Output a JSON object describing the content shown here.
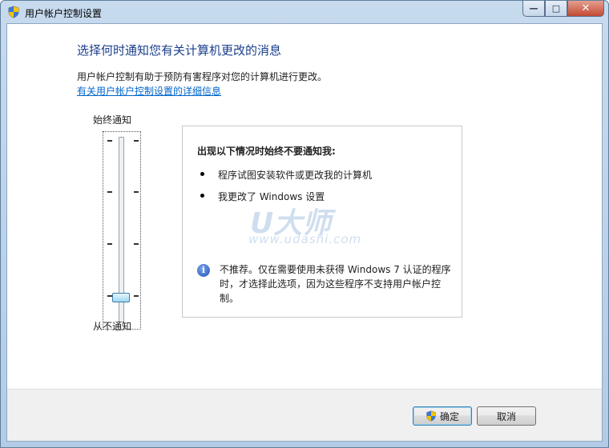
{
  "window": {
    "title": "用户帐户控制设置",
    "caption_buttons": {
      "minimize": "—",
      "maximize": "□",
      "close": "✕"
    }
  },
  "content": {
    "heading": "选择何时通知您有关计算机更改的消息",
    "description": "用户帐户控制有助于预防有害程序对您的计算机进行更改。",
    "help_link": "有关用户帐户控制设置的详细信息"
  },
  "slider": {
    "top_label": "始终通知",
    "bottom_label": "从不通知",
    "levels": 4,
    "current_level": 1,
    "current_level_fraction": 0.0
  },
  "panel": {
    "title": "出现以下情况时始终不要通知我:",
    "bullets": [
      "程序试图安装软件或更改我的计算机",
      "我更改了 Windows 设置"
    ],
    "note": "不推荐。仅在需要使用未获得 Windows 7 认证的程序时，才选择此选项，因为这些程序不支持用户帐户控制。",
    "note_icon": "info-icon"
  },
  "watermark": {
    "main": "U大师",
    "sub": "www.udashi.com"
  },
  "buttons": {
    "ok": "确定",
    "cancel": "取消"
  },
  "colors": {
    "heading": "#1a3e8c",
    "link": "#0066cc",
    "title_bar": "#c7daee"
  }
}
